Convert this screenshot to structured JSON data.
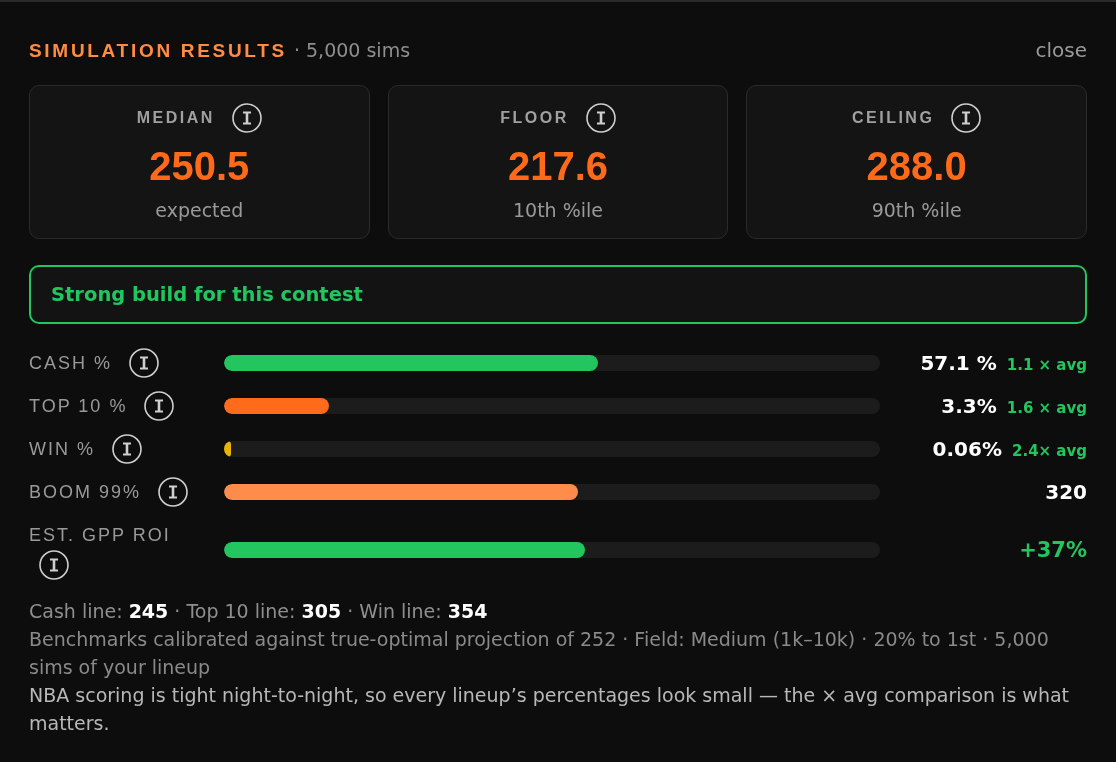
{
  "header": {
    "title": "SIMULATION RESULTS",
    "subtitle": "· 5,000 sims",
    "close_label": "close"
  },
  "summary_cards": [
    {
      "label": "MEDIAN",
      "value": "250.5",
      "caption": "expected"
    },
    {
      "label": "FLOOR",
      "value": "217.6",
      "caption": "10th %ile"
    },
    {
      "label": "CEILING",
      "value": "288.0",
      "caption": "90th %ile"
    }
  ],
  "verdict": {
    "text": "Strong build for this contest",
    "positive": true
  },
  "metrics": [
    {
      "label": "CASH %",
      "level": 0.57,
      "color": "#22c55e",
      "value": "57.1 %",
      "positive": false,
      "comparison": "1.1 × avg"
    },
    {
      "label": "TOP 10 %",
      "level": 0.16,
      "color": "#ff6b1a",
      "value": "3.3%",
      "positive": false,
      "comparison": "1.6 × avg"
    },
    {
      "label": "WIN %",
      "level": 0.01,
      "color": "#eab308",
      "value": "0.06%",
      "positive": false,
      "comparison": "2.4× avg"
    },
    {
      "label": "BOOM 99%",
      "level": 0.54,
      "color": "#ff8c4a",
      "value": "320",
      "positive": false
    },
    {
      "label": "EST. GPP ROI",
      "level": 0.55,
      "color": "#22c55e",
      "value": "+37%",
      "positive": true
    }
  ],
  "footer": {
    "thresholds": "Cash line: **245** · Top 10 line: **305** · Win line: **354**",
    "benchmarks": "Benchmarks calibrated against true-optimal projection of 252 · Field: Medium (1k–10k) · 20% to 1st · 5,000 sims of your lineup",
    "note": "NBA scoring is tight night-to-night, so every lineup’s percentages look small — the × avg comparison is what matters."
  }
}
